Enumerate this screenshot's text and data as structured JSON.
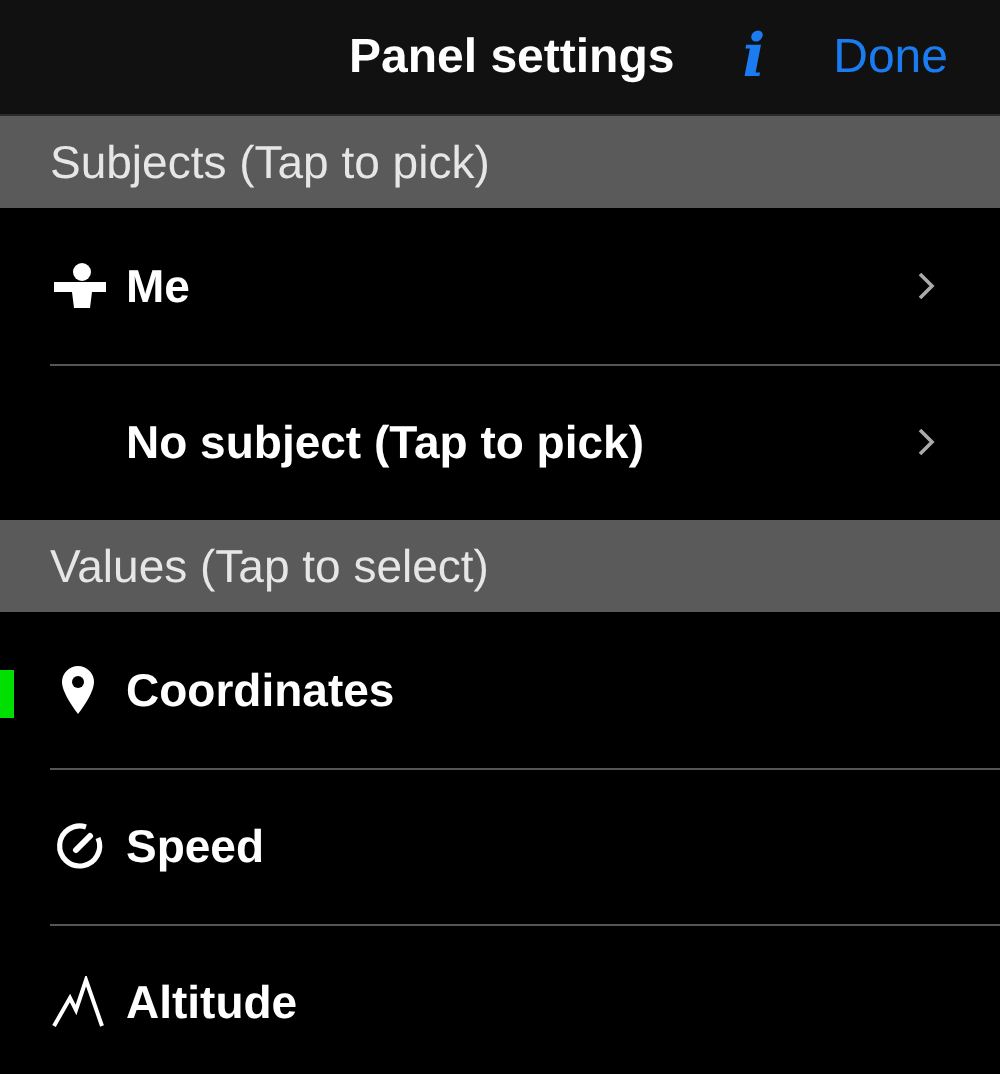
{
  "nav_bar": {
    "title": "Panel settings",
    "info": "i",
    "done": "Done"
  },
  "sections": [
    {
      "header": "Subjects (Tap to pick)",
      "items": [
        {
          "label": "Me",
          "kind": "me"
        },
        {
          "label": "No subject (Tap to pick)",
          "kind": "none"
        }
      ]
    },
    {
      "header": "Values (Tap to select)",
      "items": [
        {
          "label": "Coordinates",
          "kind": "coordinates",
          "selected": true
        },
        {
          "label": "Speed",
          "kind": "speed",
          "selected": false
        },
        {
          "label": "Altitude",
          "kind": "altitude",
          "selected": false
        }
      ]
    }
  ]
}
